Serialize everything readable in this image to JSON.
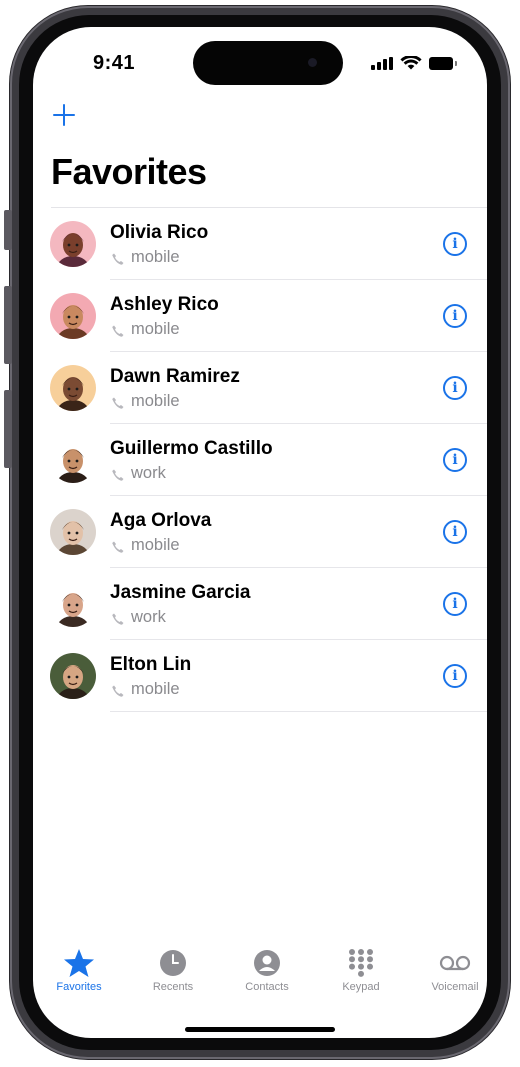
{
  "status_bar": {
    "time": "9:41"
  },
  "header": {
    "title": "Favorites",
    "add_icon": "plus-icon"
  },
  "favorites": [
    {
      "name": "Olivia Rico",
      "label": "mobile",
      "avatar_bg": "#f4b8c0",
      "face": "#7a3f2c",
      "hair": "#5a2a3a"
    },
    {
      "name": "Ashley Rico",
      "label": "mobile",
      "avatar_bg": "#f3a9b2",
      "face": "#c98960",
      "hair": "#6b3a24"
    },
    {
      "name": "Dawn Ramirez",
      "label": "mobile",
      "avatar_bg": "#f7cf9a",
      "face": "#7b4b33",
      "hair": "#3a2418"
    },
    {
      "name": "Guillermo Castillo",
      "label": "work",
      "avatar_bg": "#ffffff",
      "face": "#c8916a",
      "hair": "#2b1e17"
    },
    {
      "name": "Aga Orlova",
      "label": "mobile",
      "avatar_bg": "#dbd3cc",
      "face": "#e2c1a8",
      "hair": "#5b4634"
    },
    {
      "name": "Jasmine Garcia",
      "label": "work",
      "avatar_bg": "#ffffff",
      "face": "#d8a58a",
      "hair": "#3a2a22"
    },
    {
      "name": "Elton Lin",
      "label": "mobile",
      "avatar_bg": "#4a5d3a",
      "face": "#d6a683",
      "hair": "#2a2018"
    }
  ],
  "tabs": [
    {
      "label": "Favorites",
      "icon": "star-icon",
      "active": true
    },
    {
      "label": "Recents",
      "icon": "clock-icon",
      "active": false
    },
    {
      "label": "Contacts",
      "icon": "person-circle-icon",
      "active": false
    },
    {
      "label": "Keypad",
      "icon": "keypad-icon",
      "active": false
    },
    {
      "label": "Voicemail",
      "icon": "voicemail-icon",
      "active": false
    }
  ],
  "colors": {
    "accent": "#1a73e8",
    "secondary_text": "#8a8a8e",
    "inactive_tab": "#8e8e93"
  }
}
